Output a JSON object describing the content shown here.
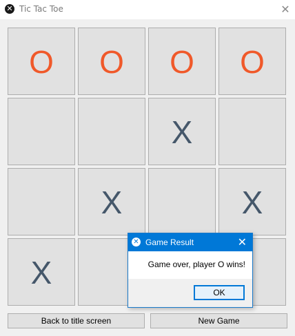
{
  "window": {
    "title": "Tic Tac Toe",
    "icon": "app-icon",
    "close_glyph": "✕"
  },
  "board": {
    "rows": [
      [
        "O",
        "O",
        "O",
        "O"
      ],
      [
        "",
        "",
        "X",
        ""
      ],
      [
        "",
        "X",
        "",
        "X"
      ],
      [
        "X",
        "",
        "",
        ""
      ]
    ],
    "colors": {
      "O": "#f0592a",
      "X": "#45576a"
    }
  },
  "buttons": {
    "back": "Back to title screen",
    "new_game": "New Game"
  },
  "dialog": {
    "title": "Game Result",
    "message": "Game over, player O wins!",
    "ok_label": "OK",
    "close_glyph": "✕"
  }
}
